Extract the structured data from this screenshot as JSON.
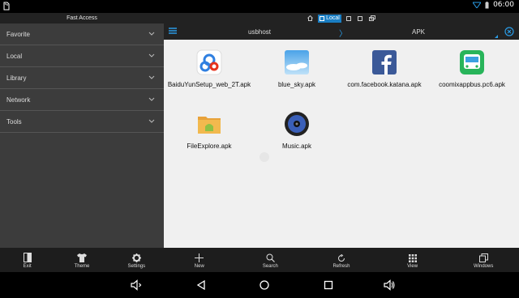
{
  "status": {
    "time": "06:00"
  },
  "drawer": {
    "title": "Fast Access",
    "items": [
      {
        "label": "Favorite"
      },
      {
        "label": "Local"
      },
      {
        "label": "Library"
      },
      {
        "label": "Network"
      },
      {
        "label": "Tools"
      }
    ],
    "bottom": [
      {
        "label": "Exit",
        "icon": "exit-icon"
      },
      {
        "label": "Theme",
        "icon": "shirt-icon"
      },
      {
        "label": "Settings",
        "icon": "gear-icon"
      }
    ]
  },
  "tabs": {
    "items": [
      {
        "label": "",
        "icon": "home-icon"
      },
      {
        "label": "Local",
        "icon": "local-icon",
        "active": true
      },
      {
        "label": "",
        "icon": "window-icon"
      },
      {
        "label": "",
        "icon": "window-icon"
      },
      {
        "label": "",
        "icon": "multi-window-icon"
      }
    ]
  },
  "path": {
    "seg1": "usbhost",
    "seg2": "APK"
  },
  "files": [
    {
      "name": "BaiduYunSetup_web_2T.apk",
      "icon": "baidu-yun-icon"
    },
    {
      "name": "blue_sky.apk",
      "icon": "blue-sky-icon"
    },
    {
      "name": "com.facebook.katana.apk",
      "icon": "facebook-icon"
    },
    {
      "name": "coomixappbus.pc6.apk",
      "icon": "bus-icon"
    },
    {
      "name": "FileExplore.apk",
      "icon": "android-folder-icon"
    },
    {
      "name": "Music.apk",
      "icon": "music-icon"
    }
  ],
  "toolbar": [
    {
      "label": "New",
      "icon": "plus-icon"
    },
    {
      "label": "Search",
      "icon": "search-icon"
    },
    {
      "label": "Refresh",
      "icon": "refresh-icon"
    },
    {
      "label": "View",
      "icon": "grid-icon"
    },
    {
      "label": "Windows",
      "icon": "windows-icon"
    }
  ],
  "colors": {
    "accent": "#2a9be5",
    "tab_active": "#1a7ec3",
    "drawer_bg": "#3c3c3c",
    "main_bg": "#f0f0f0"
  }
}
